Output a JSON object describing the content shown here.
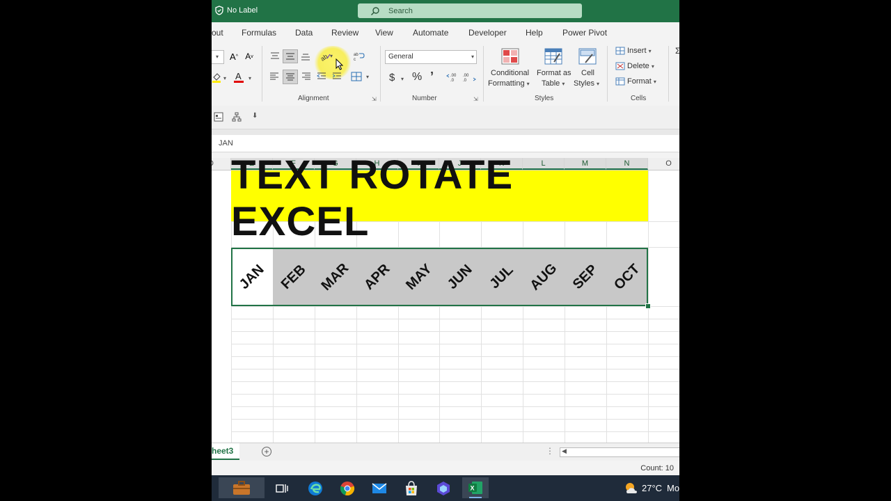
{
  "titlebar": {
    "label_text": "No Label",
    "search_placeholder": "Search"
  },
  "menu": {
    "tabs": [
      "out",
      "Formulas",
      "Data",
      "Review",
      "View",
      "Automate",
      "Developer",
      "Help",
      "Power Pivot"
    ]
  },
  "ribbon": {
    "number_format": "General",
    "groups": {
      "alignment": "Alignment",
      "number": "Number",
      "styles": "Styles",
      "cells": "Cells"
    },
    "styles": {
      "conditional_1": "Conditional",
      "conditional_2": "Formatting",
      "format_table_1": "Format as",
      "format_table_2": "Table",
      "cell_styles_1": "Cell",
      "cell_styles_2": "Styles"
    },
    "cells": {
      "insert": "Insert",
      "delete": "Delete",
      "format": "Format"
    }
  },
  "formula_bar": {
    "content": "JAN"
  },
  "grid": {
    "column_headers": [
      "D",
      "E",
      "F",
      "G",
      "H",
      "I",
      "J",
      "K",
      "L",
      "M",
      "N",
      "O"
    ],
    "title": "TEXT ROTATE EXCEL",
    "months": [
      "JAN",
      "FEB",
      "MAR",
      "APR",
      "MAY",
      "JUN",
      "JUL",
      "AUG",
      "SEP",
      "OCT"
    ]
  },
  "sheets": {
    "active": "heet3"
  },
  "status": {
    "count": "Count: 10"
  },
  "taskbar": {
    "temperature": "27°C",
    "clock_partial": "Mo"
  },
  "colors": {
    "excel_green": "#217346",
    "title_fill": "#ffff00",
    "month_fill": "#c8c8c8",
    "taskbar": "#1f2b3a"
  }
}
